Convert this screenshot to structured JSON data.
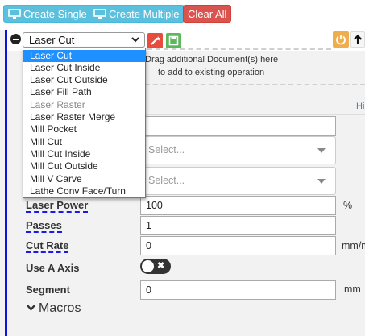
{
  "toolbar": {
    "create_single": "Create Single",
    "create_multiple": "Create Multiple",
    "clear_all": "Clear All"
  },
  "operation": {
    "selected": "Laser Cut",
    "drop_hint_line1": "Drag additional Document(s) here",
    "drop_hint_line2": "to add to existing operation",
    "hint_link": "Hi",
    "options": [
      {
        "label": "Laser Cut",
        "selected": true
      },
      {
        "label": "Laser Cut Inside"
      },
      {
        "label": "Laser Cut Outside"
      },
      {
        "label": "Laser Fill Path"
      },
      {
        "label": "Laser Raster",
        "disabled": true
      },
      {
        "label": "Laser Raster Merge"
      },
      {
        "label": "Mill Pocket"
      },
      {
        "label": "Mill Cut"
      },
      {
        "label": "Mill Cut Inside"
      },
      {
        "label": "Mill Cut Outside"
      },
      {
        "label": "Mill V Carve"
      },
      {
        "label": "Lathe Conv Face/Turn"
      }
    ]
  },
  "form": {
    "select1_placeholder": "Select...",
    "select2_placeholder": "Select...",
    "laser_power": {
      "label": "Laser Power",
      "value": "100",
      "unit": "%"
    },
    "passes": {
      "label": "Passes",
      "value": "1"
    },
    "cut_rate": {
      "label": "Cut Rate",
      "value": "0",
      "unit": "mm/m"
    },
    "use_a_axis": {
      "label": "Use A Axis",
      "on": false
    },
    "segment": {
      "label": "Segment",
      "value": "0",
      "unit": "mm"
    },
    "macros": "Macros"
  },
  "colors": {
    "info": "#5bc0de",
    "danger": "#d9534f",
    "success": "#5cb85c",
    "warning": "#f0ad4e",
    "selection": "#1e90ff",
    "accent_border": "#1111dd"
  }
}
